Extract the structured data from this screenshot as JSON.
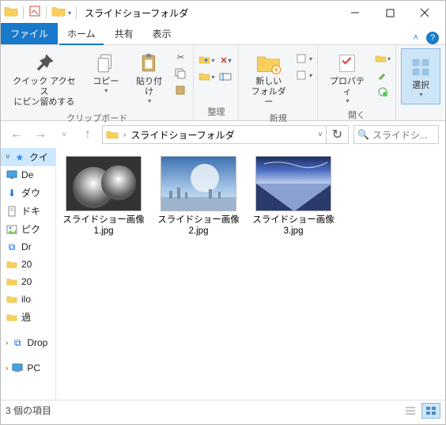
{
  "titlebar": {
    "title": "スライドショーフォルダ"
  },
  "tabs": {
    "file": "ファイル",
    "home": "ホーム",
    "share": "共有",
    "view": "表示"
  },
  "ribbon": {
    "pin_label": "クイック アクセス\nにピン留めする",
    "copy_label": "コピー",
    "paste_label": "貼り付け",
    "clipboard_group": "クリップボード",
    "organize_group": "整理",
    "new_label": "新しい\nフォルダー",
    "new_group": "新規",
    "properties_label": "プロパティ",
    "open_group": "開く",
    "select_label": "選択",
    "cut_tip": "✂",
    "move_btn": "移動",
    "copyto_btn": "コピー",
    "delete_btn": "✕",
    "rename_btn": "名前"
  },
  "address": {
    "folder": "スライドショーフォルダ"
  },
  "search": {
    "placeholder": "スライドシ..."
  },
  "sidebar": {
    "items": [
      {
        "icon": "star",
        "label": "クイ"
      },
      {
        "icon": "desktop",
        "label": "De"
      },
      {
        "icon": "download",
        "label": "ダウ"
      },
      {
        "icon": "document",
        "label": "ドキ"
      },
      {
        "icon": "picture",
        "label": "ピク"
      },
      {
        "icon": "dropbox",
        "label": "Dr"
      },
      {
        "icon": "folder",
        "label": "20"
      },
      {
        "icon": "folder",
        "label": "20"
      },
      {
        "icon": "folder",
        "label": "ilo"
      },
      {
        "icon": "folder",
        "label": "過"
      },
      {
        "icon": "dropbox",
        "label": "Drop"
      },
      {
        "icon": "pc",
        "label": "PC"
      }
    ]
  },
  "files": [
    {
      "label": "スライドショー画像1.jpg"
    },
    {
      "label": "スライドショー画像2.jpg"
    },
    {
      "label": "スライドショー画像3.jpg"
    }
  ],
  "status": {
    "count": "3 個の項目"
  }
}
